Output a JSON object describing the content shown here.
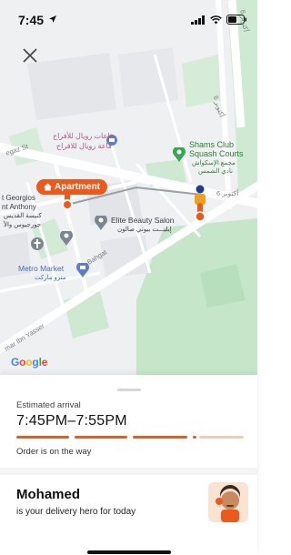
{
  "status_bar": {
    "time": "7:45"
  },
  "map": {
    "places": {
      "wedding_hall_en": "قاعات رويال للأفراح",
      "wedding_hall_ar": "قاعة رويال للافراح",
      "shams_club_en_1": "Shams Club",
      "shams_club_en_2": "Squash Courts",
      "shams_club_ar_1": "مجمع الإسكواش",
      "shams_club_ar_2": "نادي الشمس",
      "church_en_1": "t Georgios",
      "church_en_2": "nt Anthony",
      "church_ar_1": "كنيسة القديس",
      "church_ar_2": "جورجيوس والأ",
      "elite_en": "Elite Beauty Salon",
      "elite_ar": "إيليـــت بيوتي صالون",
      "metro_en": "Metro Market",
      "metro_ar": "مترو ماركت"
    },
    "roads": {
      "hegaz": "egaz St",
      "oct6_a": "6 أكتوبر",
      "oct6_b": "6 أكتوبر",
      "oct6_c": "6 أكتوبر",
      "bahgat": "Bahgat",
      "omar": "mar Ibn Yasser"
    },
    "apartment_pin": "Apartment",
    "attribution": {
      "g1": "G",
      "o1": "o",
      "o2": "o",
      "g2": "g",
      "l": "l",
      "e": "e"
    }
  },
  "delivery": {
    "arrival_label": "Estimated arrival",
    "arrival_window": "7:45PM–7:55PM",
    "status": "Order is on the way",
    "progress_fraction": 0.8,
    "rider_name": "Mohamed",
    "rider_subtitle": "is your delivery hero for today"
  },
  "colors": {
    "accent": "#ea5a1d",
    "accent_light": "#f7c8b2",
    "map_bg": "#eef0f2",
    "park_green": "#bfe6c4",
    "place_green": "#34a853",
    "place_blue": "#5b7fc7"
  },
  "icons": [
    "close-icon",
    "location-arrow-icon",
    "signal-icon",
    "wifi-icon",
    "battery-icon",
    "place-pin-icon",
    "cart-icon",
    "cross-icon",
    "bike-rider-icon",
    "home-icon"
  ]
}
